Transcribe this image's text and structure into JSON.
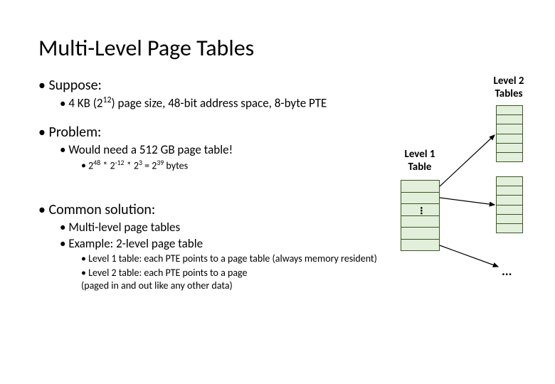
{
  "title": "Multi-Level Page Tables",
  "suppose": {
    "heading": "Suppose:",
    "detail_html": "4 KB (2<sup>12</sup>) page size, 48-bit address space, 8-byte PTE"
  },
  "problem": {
    "heading": "Problem:",
    "detail": "Would need a 512 GB page table!",
    "calc_html": "2<sup>48</sup> * 2<sup>-12</sup> * 2<sup>3</sup> = 2<sup>39</sup> bytes"
  },
  "solution": {
    "heading": "Common solution:",
    "items": [
      "Multi-level page tables",
      "Example: 2-level page table"
    ],
    "details": [
      "Level 1 table: each PTE points to a page table (always memory resident)",
      "Level 2 table: each PTE points to a page\n(paged in and out like any other data)"
    ]
  },
  "diagram": {
    "level2_label": "Level 2\nTables",
    "level1_label": "Level 1\nTable",
    "l1_dots": "...",
    "l2_dots": "..."
  }
}
